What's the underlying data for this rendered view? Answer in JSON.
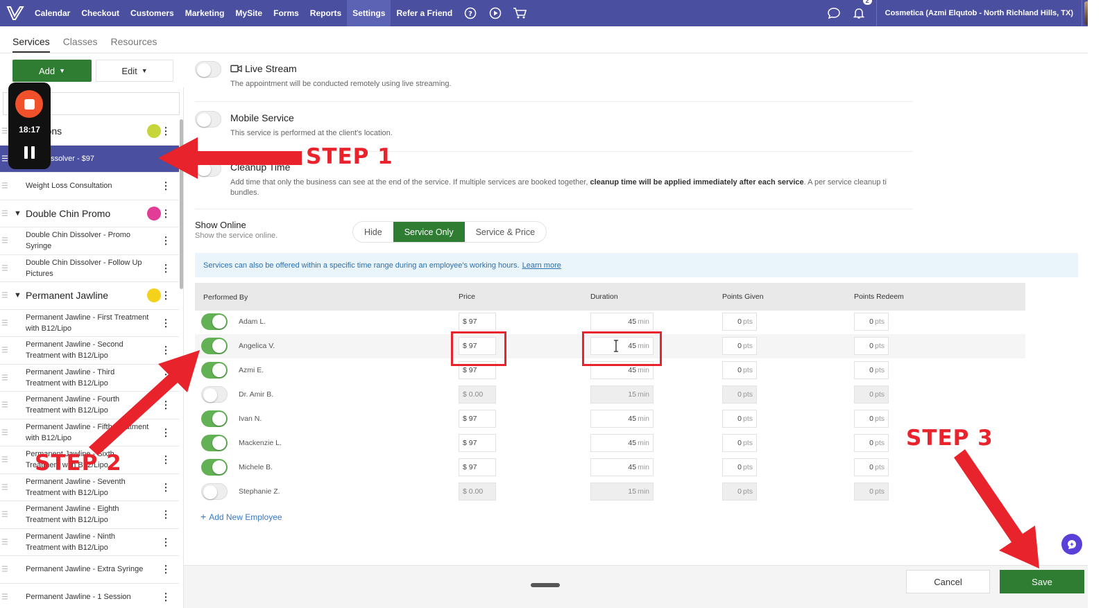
{
  "topnav": {
    "items": [
      "Calendar",
      "Checkout",
      "Customers",
      "Marketing",
      "MySite",
      "Forms",
      "Reports",
      "Settings",
      "Refer a Friend"
    ],
    "notification_count": "2",
    "business_name": "Cosmetica (Azmi Elqutob - North Richland Hills, TX)"
  },
  "subtabs": [
    "Services",
    "Classes",
    "Resources"
  ],
  "toolbar": {
    "add_label": "Add",
    "edit_label": "Edit"
  },
  "recorder": {
    "time": "18:17"
  },
  "service_list": [
    {
      "type": "category",
      "label": "ultations",
      "color": "#c6d63a"
    },
    {
      "type": "item",
      "label": "Chin Dissolver - $97",
      "selected": true
    },
    {
      "type": "item",
      "label": "Weight Loss Consultation"
    },
    {
      "type": "category",
      "label": "Double Chin Promo",
      "color": "#e23d96"
    },
    {
      "type": "item",
      "label": "Double Chin Dissolver - Promo Syringe"
    },
    {
      "type": "item",
      "label": "Double Chin Dissolver - Follow Up Pictures"
    },
    {
      "type": "category",
      "label": "Permanent Jawline",
      "color": "#f4d11a"
    },
    {
      "type": "item",
      "label": "Permanent Jawline - First Treatment with B12/Lipo"
    },
    {
      "type": "item",
      "label": "Permanent Jawline - Second Treatment with B12/Lipo"
    },
    {
      "type": "item",
      "label": "Permanent Jawline - Third Treatment with B12/Lipo"
    },
    {
      "type": "item",
      "label": "Permanent Jawline - Fourth Treatment with B12/Lipo"
    },
    {
      "type": "item",
      "label": "Permanent Jawline - Fifth Treatment with B12/Lipo"
    },
    {
      "type": "item",
      "label": "Permanent Jawline - Sixth Treatment with B12/Lipo"
    },
    {
      "type": "item",
      "label": "Permanent Jawline - Seventh Treatment with B12/Lipo"
    },
    {
      "type": "item",
      "label": "Permanent Jawline - Eighth Treatment with B12/Lipo"
    },
    {
      "type": "item",
      "label": "Permanent Jawline - Ninth Treatment with B12/Lipo"
    },
    {
      "type": "item",
      "label": "Permanent Jawline - Extra Syringe"
    },
    {
      "type": "item",
      "label": "Permanent Jawline - 1 Session"
    }
  ],
  "options": {
    "live_stream": {
      "title": "Live Stream",
      "desc": "The appointment will be conducted remotely using live streaming.",
      "enabled": false
    },
    "mobile_service": {
      "title": "Mobile Service",
      "desc": "This service is performed at the client's location.",
      "enabled": false
    },
    "cleanup_time": {
      "title": "Cleanup Time",
      "desc_a": "Add time that only the business can see at the end of the service. If multiple services are booked together, ",
      "desc_bold": "cleanup time will be applied immediately after each service",
      "desc_b": ". A per service cleanup ti",
      "desc_c": "bundles.",
      "enabled": false
    }
  },
  "show_online": {
    "title": "Show Online",
    "desc": "Show the service online.",
    "options": [
      "Hide",
      "Service Only",
      "Service & Price"
    ],
    "selected": "Service Only"
  },
  "info_banner": {
    "text": "Services can also be offered within a specific time range during an employee's working hours.",
    "link": "Learn more"
  },
  "employees_table": {
    "headers": [
      "Performed By",
      "Price",
      "Duration",
      "Points Given",
      "Points Redeem"
    ],
    "rows": [
      {
        "name": "Adam L.",
        "enabled": true,
        "price": "$ 97",
        "duration": "45",
        "points_given": "0",
        "points_redeem": "0"
      },
      {
        "name": "Angelica V.",
        "enabled": true,
        "price": "$ 97",
        "duration": "45",
        "points_given": "0",
        "points_redeem": "0"
      },
      {
        "name": "Azmi E.",
        "enabled": true,
        "price": "$ 97",
        "duration": "45",
        "points_given": "0",
        "points_redeem": "0"
      },
      {
        "name": "Dr. Amir B.",
        "enabled": false,
        "price": "$ 0.00",
        "duration": "15",
        "points_given": "0",
        "points_redeem": "0"
      },
      {
        "name": "Ivan N.",
        "enabled": true,
        "price": "$ 97",
        "duration": "45",
        "points_given": "0",
        "points_redeem": "0"
      },
      {
        "name": "Mackenzie L.",
        "enabled": true,
        "price": "$ 97",
        "duration": "45",
        "points_given": "0",
        "points_redeem": "0"
      },
      {
        "name": "Michele B.",
        "enabled": true,
        "price": "$ 97",
        "duration": "45",
        "points_given": "0",
        "points_redeem": "0"
      },
      {
        "name": "Stephanie Z.",
        "enabled": false,
        "price": "$ 0.00",
        "duration": "15",
        "points_given": "0",
        "points_redeem": "0"
      }
    ],
    "duration_unit": "min",
    "points_unit": "pts",
    "add_employee_label": "Add New Employee"
  },
  "footer": {
    "cancel_label": "Cancel",
    "save_label": "Save"
  },
  "annotations": {
    "step1": "STEP 1",
    "step2": "STEP 2",
    "step3": "STEP 3",
    "color": "#e8232b"
  }
}
